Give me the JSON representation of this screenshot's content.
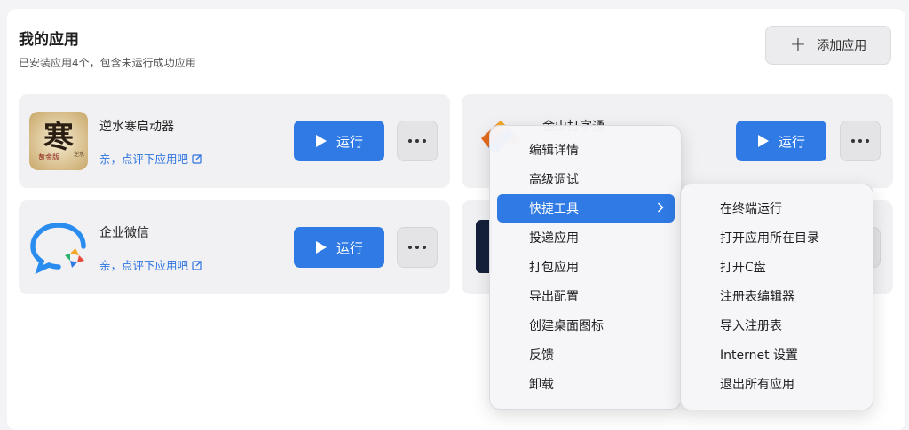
{
  "header": {
    "title": "我的应用",
    "subtitle": "已安装应用4个，包含未运行成功应用",
    "add_label": "添加应用"
  },
  "apps": [
    {
      "name": "逆水寒启动器",
      "review": "亲，点评下应用吧",
      "run_label": "运行"
    },
    {
      "name": "金山打字通",
      "run_label": "运行"
    },
    {
      "name": "企业微信",
      "review": "亲，点评下应用吧",
      "run_label": "运行"
    }
  ],
  "context_menu": {
    "items": [
      "编辑详情",
      "高级调试",
      "快捷工具",
      "投递应用",
      "打包应用",
      "导出配置",
      "创建桌面图标",
      "反馈",
      "卸载"
    ],
    "active_index": 2
  },
  "submenu": {
    "items": [
      "在终端运行",
      "打开应用所在目录",
      "打开C盘",
      "注册表编辑器",
      "导入注册表",
      "Internet 设置",
      "退出所有应用"
    ]
  },
  "colors": {
    "accent": "#2f7ae5",
    "link": "#2f74e0"
  }
}
